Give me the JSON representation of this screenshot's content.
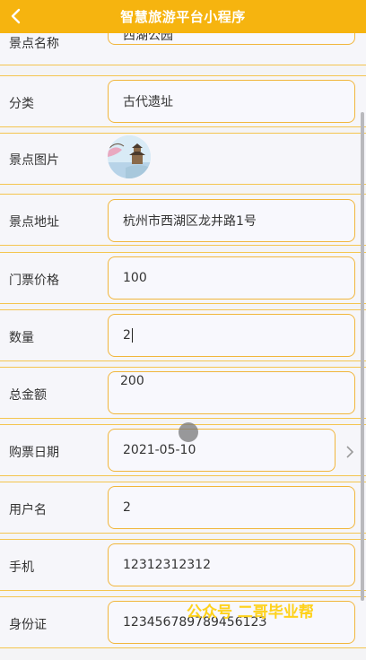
{
  "header": {
    "title": "智慧旅游平台小程序",
    "back_icon": "chevron-left-icon",
    "background": "#f6b40f"
  },
  "form": {
    "fields": [
      {
        "label": "景点名称",
        "value": "西湖公园"
      },
      {
        "label": "分类",
        "value": "古代遗址"
      },
      {
        "label": "景点图片",
        "value": ""
      },
      {
        "label": "景点地址",
        "value": "杭州市西湖区龙井路1号"
      },
      {
        "label": "门票价格",
        "value": "100"
      },
      {
        "label": "数量",
        "value": "2"
      },
      {
        "label": "总金额",
        "value": "200"
      },
      {
        "label": "购票日期",
        "value": "2021-05-10"
      },
      {
        "label": "用户名",
        "value": "2"
      },
      {
        "label": "手机",
        "value": "12312312312"
      },
      {
        "label": "身份证",
        "value": "12345678978945612З"
      }
    ]
  },
  "watermark": "公众号 二哥毕业帮",
  "colors": {
    "accent": "#f6b40f",
    "field_border": "#f1b63c",
    "row_border": "#f4c54f"
  }
}
